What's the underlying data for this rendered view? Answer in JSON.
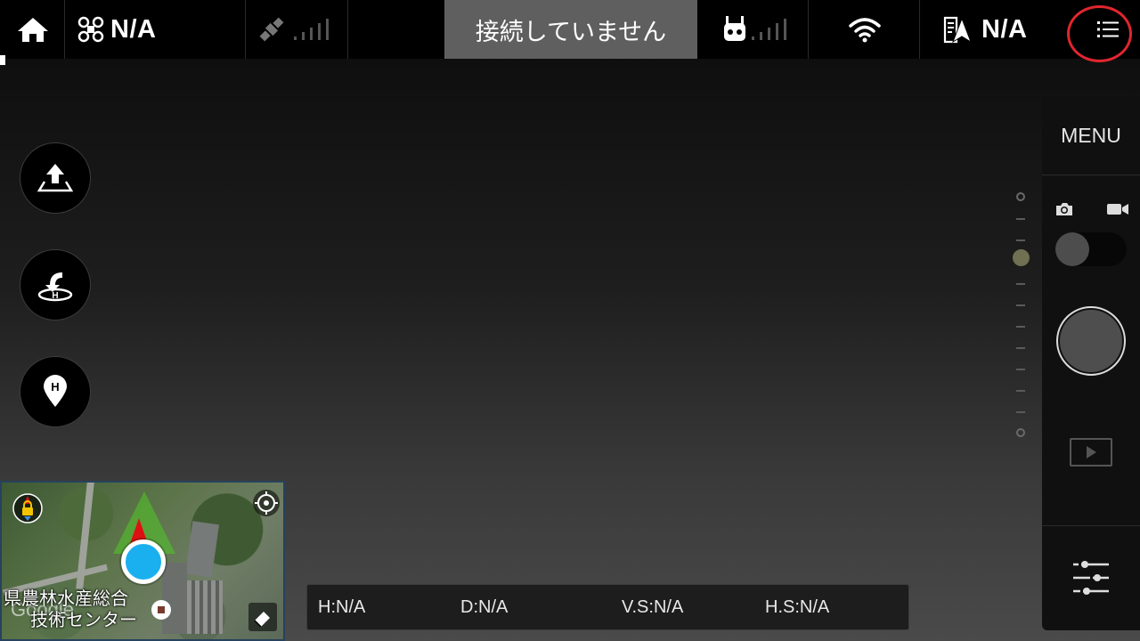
{
  "topbar": {
    "aircraft_status": "N/A",
    "connection_status": "接続していません",
    "flight_mode": "N/A"
  },
  "right_panel": {
    "menu_label": "MENU"
  },
  "minimap": {
    "place_label_line1": "県農林水産総合",
    "place_label_line2": "技術センター",
    "watermark": "Google"
  },
  "telemetry": {
    "height": "H:N/A",
    "distance": "D:N/A",
    "vertical_speed": "V.S:N/A",
    "horizontal_speed": "H.S:N/A"
  },
  "colors": {
    "accent_blue": "#1ab0f0",
    "annotation_red": "#e0262e",
    "status_box": "#5f5f5f"
  },
  "icons": [
    "home-icon",
    "drone-icon",
    "satellite-icon",
    "remote-controller-icon",
    "wifi-icon",
    "flight-mode-icon",
    "list-menu-icon",
    "takeoff-icon",
    "return-home-icon",
    "home-point-icon",
    "camera-icon",
    "video-icon",
    "play-icon",
    "settings-sliders-icon",
    "lock-north-icon",
    "locate-icon",
    "eraser-icon",
    "stop-icon"
  ]
}
